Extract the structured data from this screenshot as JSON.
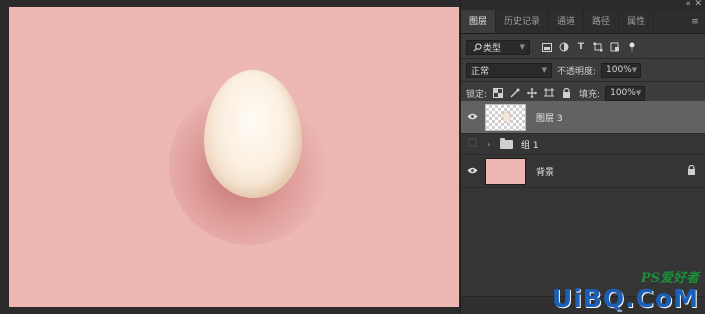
{
  "panel": {
    "controls": {
      "collapse": "«",
      "close": "✕"
    },
    "tabs": [
      {
        "label": "图层"
      },
      {
        "label": "历史记录"
      },
      {
        "label": "通道"
      },
      {
        "label": "路径"
      },
      {
        "label": "属性"
      }
    ],
    "menu_icon": "≡",
    "filter": {
      "icon": "search-icon",
      "kind_label": "类型"
    },
    "blend_mode": "正常",
    "opacity_label": "不透明度:",
    "opacity_value": "100%",
    "lock_label": "锁定:",
    "fill_label": "填充:",
    "fill_value": "100%",
    "layers": [
      {
        "name": "图层 3",
        "visible": true,
        "selected": true,
        "kind": "pixel"
      },
      {
        "name": "组 1",
        "visible": false,
        "selected": false,
        "kind": "group"
      },
      {
        "name": "背景",
        "visible": true,
        "selected": false,
        "kind": "background",
        "locked": true
      }
    ]
  },
  "canvas": {
    "background_color": "#edb8b4",
    "egg_color": "#fbefe0"
  },
  "watermark": {
    "top": "PS爱好者",
    "main": "UiBQ.CoM"
  }
}
